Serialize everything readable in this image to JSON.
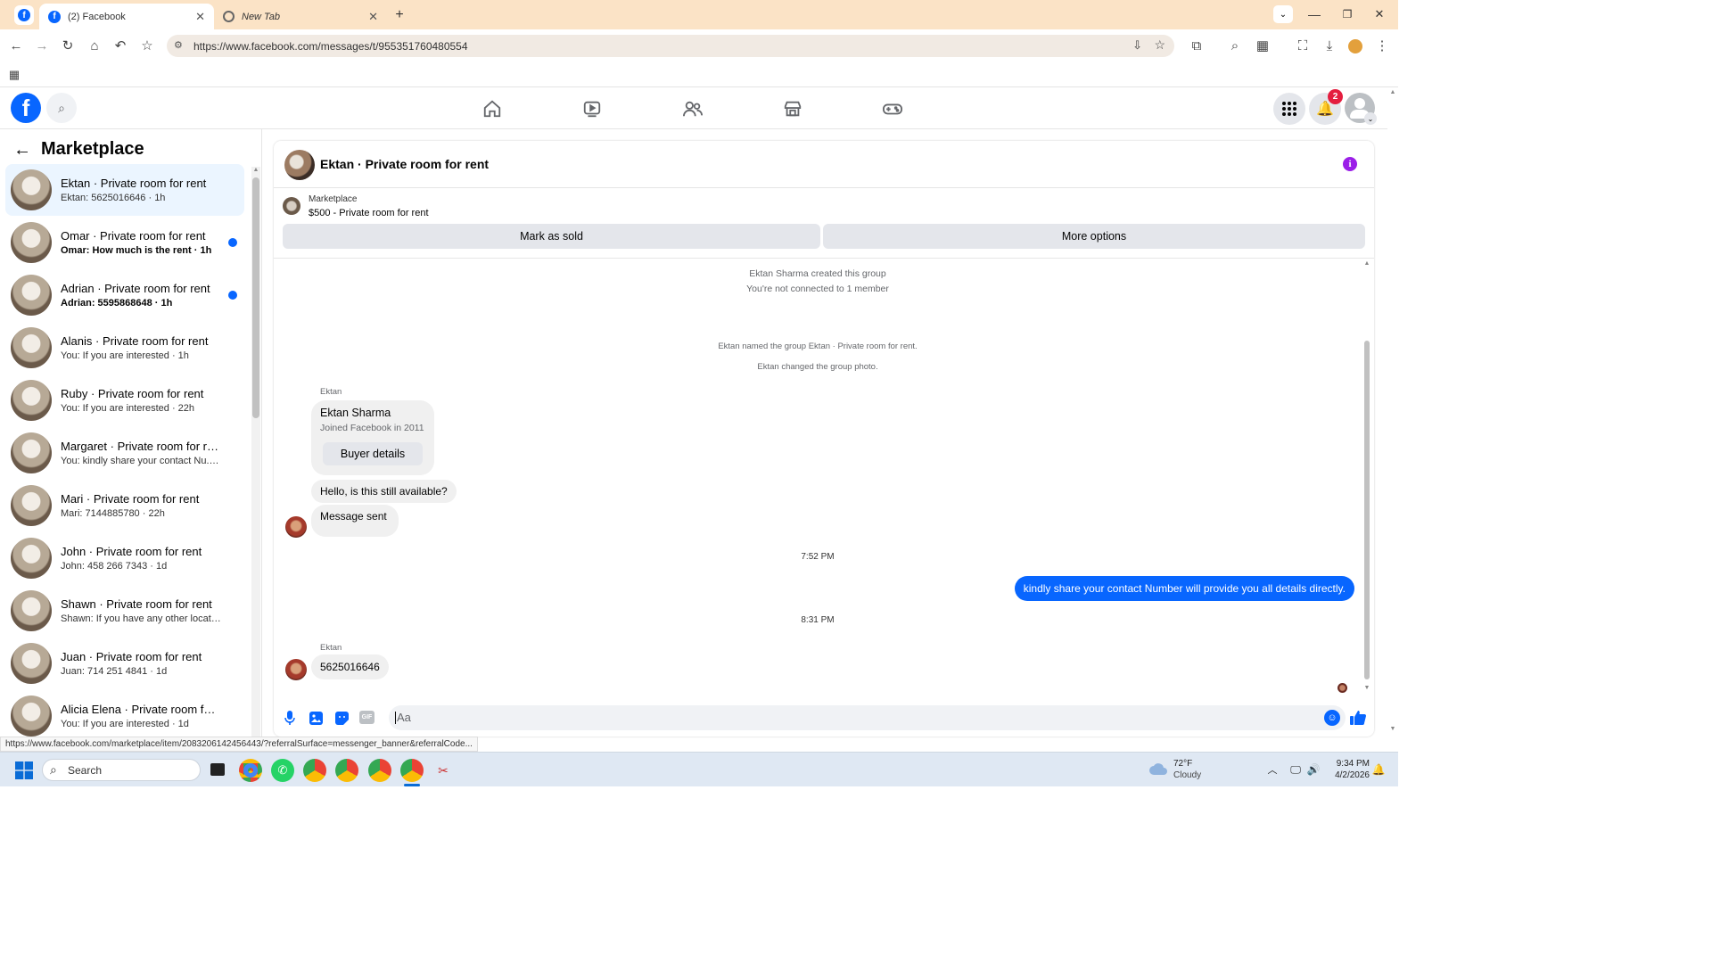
{
  "browser": {
    "tabs": [
      {
        "label": "(2) Facebook",
        "close": "✕"
      },
      {
        "label": "New Tab",
        "close": "✕"
      }
    ],
    "new_tab": "+",
    "url": "https://www.facebook.com/messages/t/955351760480554",
    "status_url": "https://www.facebook.com/marketplace/item/2083206142456443/?referralSurface=messenger_banner&referralCode..."
  },
  "fb": {
    "notification_count": "2",
    "brand_color": "#0866ff",
    "nav_icons": [
      "home-icon",
      "video-icon",
      "friends-icon",
      "marketplace-icon",
      "gaming-icon"
    ]
  },
  "sidebar": {
    "title": "Marketplace",
    "conversations": [
      {
        "title": "Ektan · Private room for rent",
        "preview": "Ektan: 5625016646 · 1h",
        "selected": true,
        "unread": false
      },
      {
        "title": "Omar · Private room for rent",
        "preview": "Omar: How much is the rent · 1h",
        "selected": false,
        "unread": true
      },
      {
        "title": "Adrian · Private room for rent",
        "preview": "Adrian: 5595868648 · 1h",
        "selected": false,
        "unread": true
      },
      {
        "title": "Alanis · Private room for rent",
        "preview": "You: If you are interested · 1h",
        "selected": false,
        "unread": false
      },
      {
        "title": "Ruby · Private room for rent",
        "preview": "You: If you are interested · 22h",
        "selected": false,
        "unread": false
      },
      {
        "title": "Margaret · Private room for rent",
        "preview": "You: kindly share your contact Nu... · 22h",
        "selected": false,
        "unread": false
      },
      {
        "title": "Mari · Private room for rent",
        "preview": "Mari: 7144885780 · 22h",
        "selected": false,
        "unread": false
      },
      {
        "title": "John · Private room for rent",
        "preview": "John: 458 266 7343 · 1d",
        "selected": false,
        "unread": false
      },
      {
        "title": "Shawn · Private room for rent",
        "preview": "Shawn: If you have any other locati... · 1d",
        "selected": false,
        "unread": false
      },
      {
        "title": "Juan · Private room for rent",
        "preview": "Juan: 714 251 4841 · 1d",
        "selected": false,
        "unread": false
      },
      {
        "title": "Alicia Elena · Private room for re...",
        "preview": "You: If you are interested · 1d",
        "selected": false,
        "unread": false
      }
    ]
  },
  "chat": {
    "title": "Ektan · Private room for rent",
    "listing": {
      "source": "Marketplace",
      "title": "$500 - Private room for rent"
    },
    "mark_sold": "Mark as sold",
    "more_options": "More options",
    "system1": "Ektan Sharma created this group",
    "system2": "You're not connected to 1 member",
    "system3": "Ektan named the group Ektan · Private room for rent.",
    "system4": "Ektan changed the group photo.",
    "sender1": "Ektan",
    "card_name": "Ektan Sharma",
    "card_sub": "Joined Facebook in 2011",
    "buyer_details": "Buyer details",
    "msg1": "Hello, is this still available?",
    "msg2": "Message sent",
    "time1": "7:52 PM",
    "my_msg": "kindly share your contact Number will provide you all details directly.",
    "time2": "8:31 PM",
    "sender2": "Ektan",
    "msg3": "5625016646",
    "composer_placeholder": "Aa",
    "outgoing_color": "#0866ff"
  },
  "taskbar": {
    "search": "Search",
    "weather_temp": "72°F",
    "weather_desc": "Cloudy",
    "time": "9:34 PM",
    "date": "4/2/2026"
  }
}
